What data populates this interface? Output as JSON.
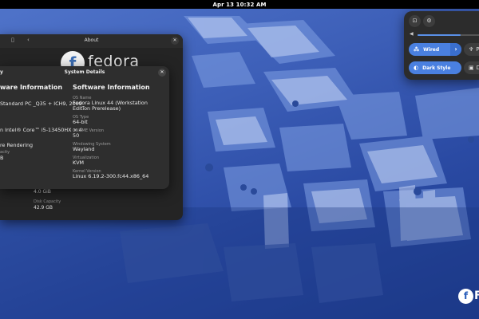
{
  "top_bar": {
    "clock": "Apr 13  10:32 AM"
  },
  "about_window": {
    "title": "About",
    "logo_text": "fedora",
    "rows": [
      {
        "label": "",
        "value": "4.0 GiB"
      },
      {
        "label": "Disk Capacity",
        "value": "42.9 GB"
      }
    ]
  },
  "system_details": {
    "title": "System Details",
    "left_title": "y",
    "hardware": {
      "heading": "ware Information",
      "rows": [
        {
          "label": "",
          "value": "Standard PC _Q35 + ICH9, 2009_"
        },
        {
          "label": "",
          "value": ""
        },
        {
          "label": "",
          "value": "n Intel® Core™ i5-13450HX × 4"
        },
        {
          "label": "",
          "value": "re Rendering"
        },
        {
          "label": "acity",
          "value": "B"
        }
      ]
    },
    "software": {
      "heading": "Software Information",
      "rows": [
        {
          "label": "OS Name",
          "value": "Fedora Linux 44 (Workstation Edition Prerelease)"
        },
        {
          "label": "OS Type",
          "value": "64-bit"
        },
        {
          "label": "GNOME Version",
          "value": "50"
        },
        {
          "label": "Windowing System",
          "value": "Wayland"
        },
        {
          "label": "Virtualization",
          "value": "KVM"
        },
        {
          "label": "Kernel Version",
          "value": "Linux 6.19.2-300.fc44.x86_64"
        }
      ]
    }
  },
  "quick_settings": {
    "volume_level": 0.6,
    "tiles": [
      {
        "label": "Wired",
        "icon": "network-wired-icon"
      },
      {
        "label": "Dark Style",
        "icon": "dark-style-icon"
      }
    ],
    "grey_tile_labels": [
      "P",
      "D"
    ]
  },
  "desktop_badge": {
    "text": "F"
  },
  "colors": {
    "accent": "#4a80e0",
    "panel": "#2c2c2c",
    "wallpaper": "#2a4aa3"
  }
}
